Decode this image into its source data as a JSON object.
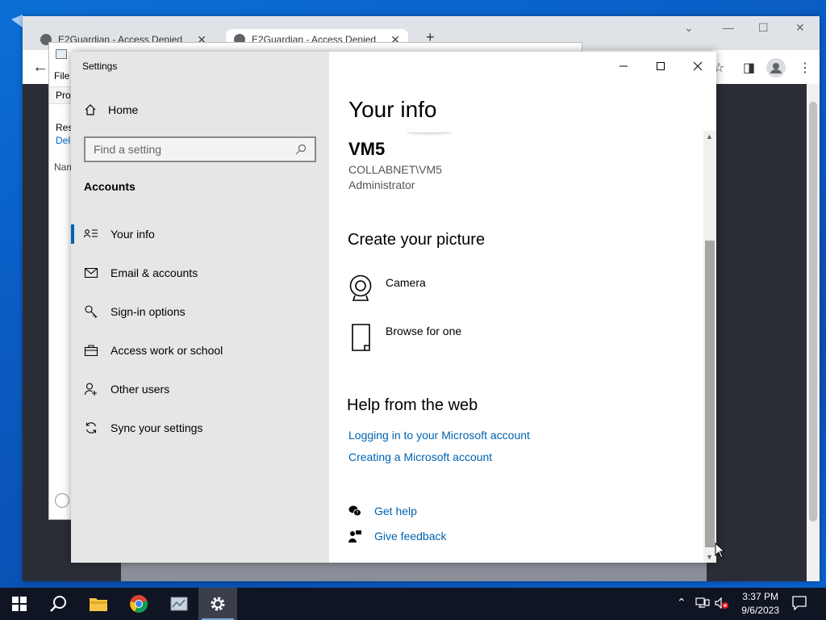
{
  "browser": {
    "tabs": [
      {
        "label": "E2Guardian - Access Denied"
      },
      {
        "label": "E2Guardian - Access Denied"
      }
    ],
    "new_tab_symbol": "+"
  },
  "background_window": {
    "menu_file": "File",
    "row_pro": "Pro",
    "row_res": "Res",
    "row_del": "Del",
    "row_nam": "Nam"
  },
  "settings": {
    "title": "Settings",
    "home_label": "Home",
    "search_placeholder": "Find a setting",
    "section_title": "Accounts",
    "nav_items": [
      {
        "label": "Your info",
        "icon": "user-card-icon",
        "active": true
      },
      {
        "label": "Email & accounts",
        "icon": "mail-icon",
        "active": false
      },
      {
        "label": "Sign-in options",
        "icon": "key-icon",
        "active": false
      },
      {
        "label": "Access work or school",
        "icon": "briefcase-icon",
        "active": false
      },
      {
        "label": "Other users",
        "icon": "add-person-icon",
        "active": false
      },
      {
        "label": "Sync your settings",
        "icon": "sync-icon",
        "active": false
      }
    ],
    "page_title": "Your info",
    "user": {
      "name": "VM5",
      "account": "COLLABNET\\VM5",
      "role": "Administrator"
    },
    "create_picture": {
      "heading": "Create your picture",
      "options": [
        {
          "label": "Camera",
          "icon": "camera-icon"
        },
        {
          "label": "Browse for one",
          "icon": "file-icon"
        }
      ]
    },
    "help": {
      "heading": "Help from the web",
      "links": [
        "Logging in to your Microsoft account",
        "Creating a Microsoft account"
      ]
    },
    "support": {
      "get_help": "Get help",
      "give_feedback": "Give feedback"
    }
  },
  "taskbar": {
    "time": "3:37 PM",
    "date": "9/6/2023"
  },
  "colors": {
    "accent": "#0063b1",
    "nav_bg": "#e6e6e6",
    "taskbar_bg": "#0f1522"
  }
}
